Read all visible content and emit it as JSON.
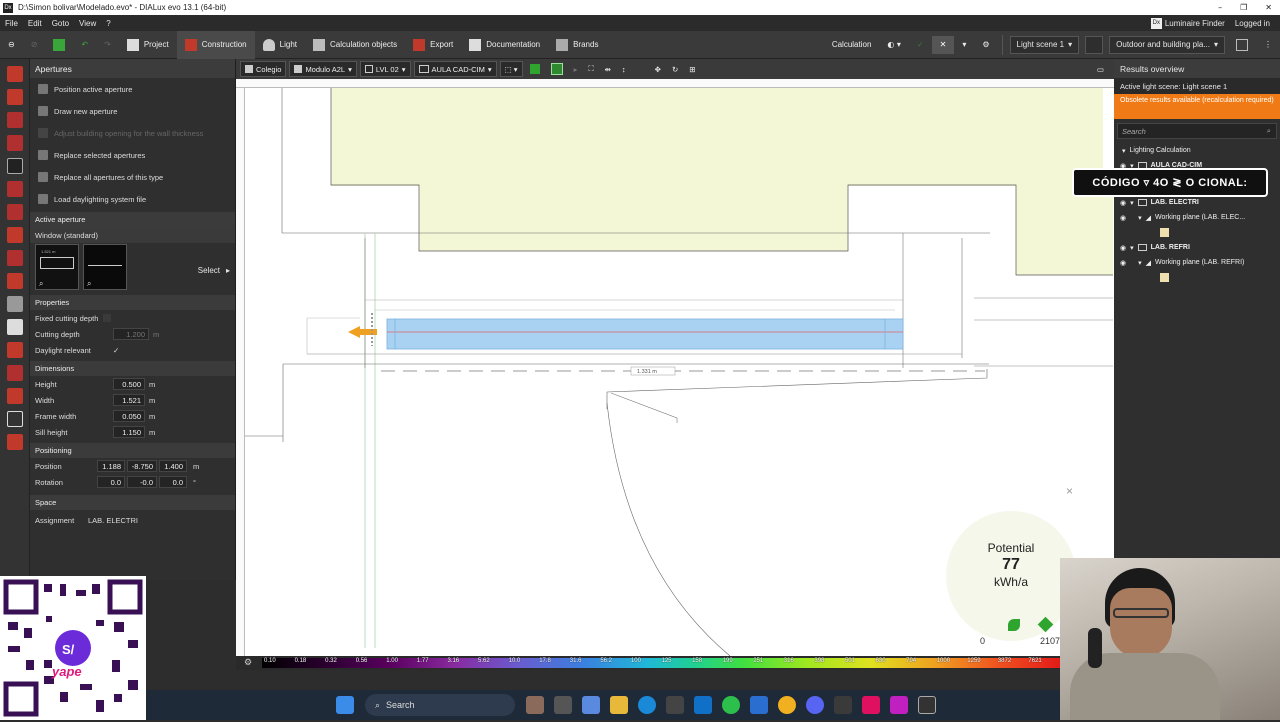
{
  "window": {
    "title": "D:\\Simon bolivar\\Modelado.evo* - DIALux evo 13.1  (64-bit)",
    "controls": [
      "–",
      "❐",
      "✕"
    ]
  },
  "menu": {
    "items": [
      "File",
      "Edit",
      "Goto",
      "View",
      "?"
    ],
    "luminaire_finder": "Luminaire Finder",
    "logged_in": "Logged in"
  },
  "toolbar": {
    "project": "Project",
    "construction": "Construction",
    "light": "Light",
    "calc_objects": "Calculation objects",
    "export": "Export",
    "documentation": "Documentation",
    "brands": "Brands",
    "calculation": "Calculation",
    "light_scene": "Light scene 1",
    "outdoor": "Outdoor and building pla..."
  },
  "left_panel": {
    "header": "Apertures",
    "actions": [
      {
        "label": "Position active aperture",
        "enabled": true
      },
      {
        "label": "Draw new aperture",
        "enabled": true
      },
      {
        "label": "Adjust building opening for the wall thickness",
        "enabled": false
      },
      {
        "label": "Replace selected apertures",
        "enabled": true
      },
      {
        "label": "Replace all apertures of this type",
        "enabled": true
      },
      {
        "label": "Load daylighting system file",
        "enabled": true
      }
    ],
    "active_aperture": {
      "header": "Active aperture",
      "type": "Window (standard)",
      "preview_dim_w": "1.521 m",
      "preview_dim_h": "0.500 m",
      "select": "Select"
    },
    "properties": {
      "header": "Properties",
      "fixed_cutting_depth": "Fixed cutting depth",
      "cutting_depth": "Cutting depth",
      "cutting_depth_value": "1.200",
      "cutting_depth_unit": "m",
      "daylight_relevant": "Daylight relevant",
      "check": "✓"
    },
    "dimensions": {
      "header": "Dimensions",
      "rows": [
        {
          "label": "Height",
          "value": "0.500",
          "unit": "m"
        },
        {
          "label": "Width",
          "value": "1.521",
          "unit": "m"
        },
        {
          "label": "Frame width",
          "value": "0.050",
          "unit": "m"
        },
        {
          "label": "Sill height",
          "value": "1.150",
          "unit": "m"
        }
      ]
    },
    "positioning": {
      "header": "Positioning",
      "position_label": "Position",
      "position": [
        "1.188",
        "-8.750",
        "1.400"
      ],
      "position_unit": "m",
      "rotation_label": "Rotation",
      "rotation": [
        "0.0",
        "-0.0",
        "0.0"
      ],
      "rotation_unit": "°"
    },
    "space": {
      "header": "Space",
      "assignment_label": "Assignment",
      "assignment": "LAB. ELECTRI"
    }
  },
  "canvas_toolbar": {
    "building": "Colegio",
    "module": "Modulo A2L",
    "level": "LVL 02",
    "cad": "AULA CAD-CIM"
  },
  "drawing": {
    "dim_label": "1.331 m"
  },
  "potential": {
    "label": "Potential",
    "value": "77",
    "unit": "kWh/a",
    "min": "0",
    "max": "2107"
  },
  "results": {
    "header": "Results overview",
    "active_scene": "Active light scene: Light scene 1",
    "warning": "Obsolete results available (recalculation required)",
    "search": "Search",
    "tree": [
      {
        "label": "Lighting Calculation",
        "level": 0
      },
      {
        "label": "AULA CAD-CIM",
        "level": 1
      },
      {
        "label": "LAB. ELECTRI",
        "level": 1
      },
      {
        "label": "Working plane (LAB. ELEC...",
        "level": 2
      },
      {
        "label": "LAB. REFRI",
        "level": 1
      },
      {
        "label": "Working plane (LAB. REFRI)",
        "level": 2
      }
    ]
  },
  "overlay_banner": "CÓDIGO ▿ 4O ≷ O CIONAL:",
  "scale_ticks": [
    "0.10",
    "0.18",
    "0.32",
    "0.56",
    "1.00",
    "1.77",
    "3.16",
    "5.62",
    "10.0",
    "17.8",
    "31.6",
    "56.2",
    "100",
    "125",
    "158",
    "199",
    "251",
    "316",
    "398",
    "501",
    "630",
    "794",
    "1000",
    "1259",
    "3872",
    "7621"
  ],
  "taskbar": {
    "search": "Search"
  }
}
